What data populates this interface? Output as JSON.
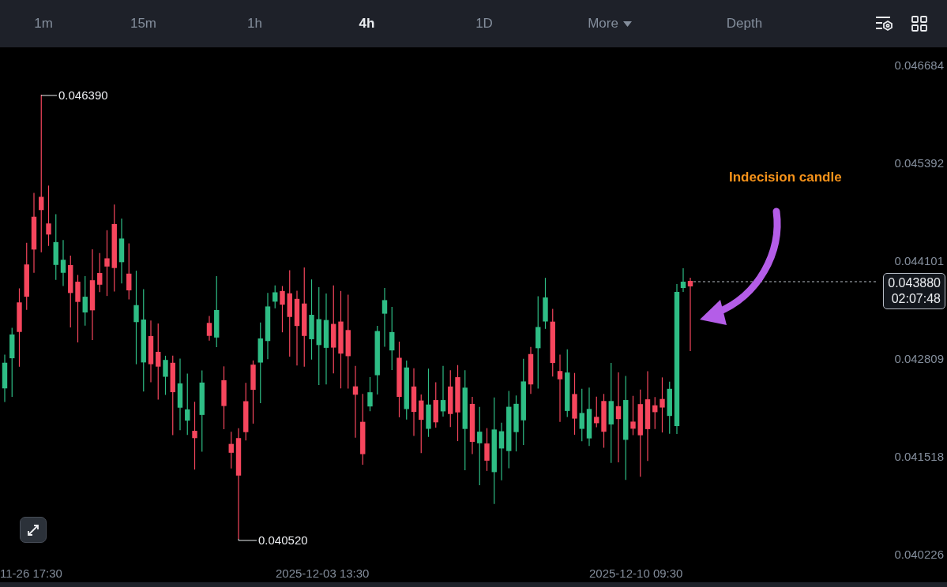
{
  "toolbar": {
    "intervals": [
      {
        "label": "1m",
        "selected": false
      },
      {
        "label": "15m",
        "selected": false
      },
      {
        "label": "1h",
        "selected": false
      },
      {
        "label": "4h",
        "selected": true
      },
      {
        "label": "1D",
        "selected": false
      }
    ],
    "more": {
      "label": "More"
    },
    "depth": {
      "label": "Depth",
      "selected": false
    }
  },
  "chart": {
    "price_ticks": [
      "0.046684",
      "0.045392",
      "0.044101",
      "0.042809",
      "0.041518",
      "0.040226"
    ],
    "time_ticks": [
      "11-26 17:30",
      "2025-12-03 13:30",
      "2025-12-10 09:30"
    ],
    "high_marker": "0.046390",
    "low_marker": "0.040520",
    "current_price": "0.043880",
    "countdown": "02:07:48",
    "annotation": "Indecision candle"
  }
}
